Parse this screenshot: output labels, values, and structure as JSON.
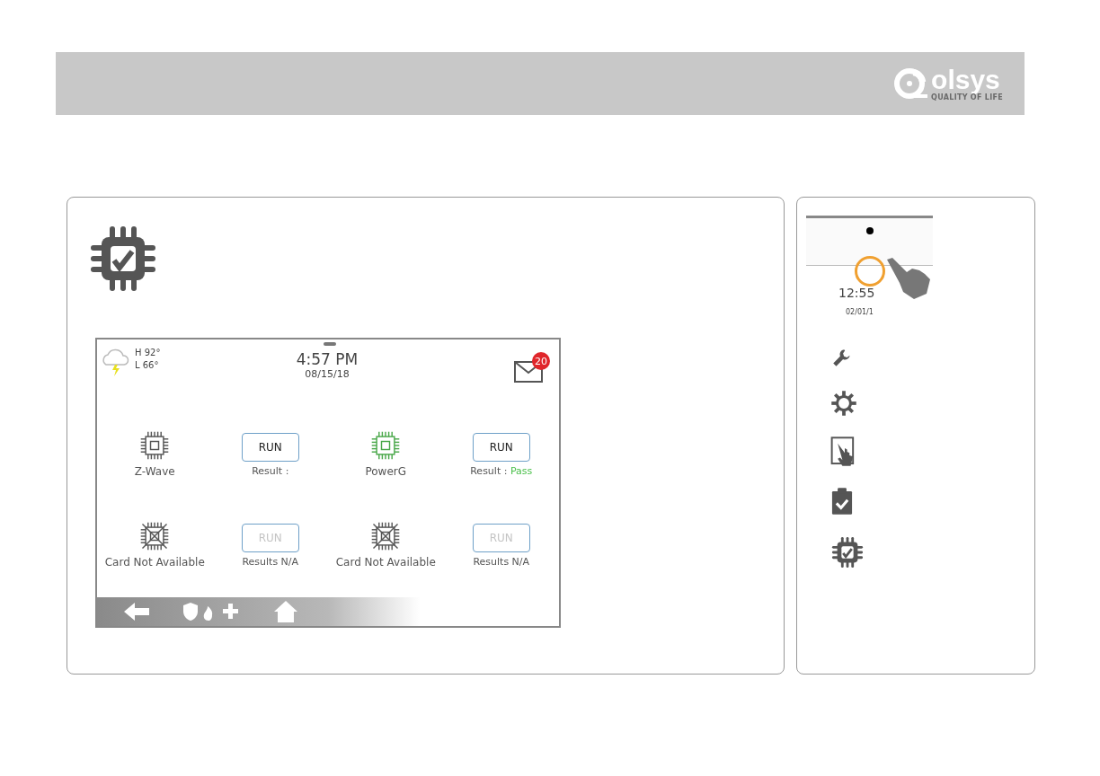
{
  "header": {
    "logo": {
      "name": "olsys",
      "tagline": "QUALITY OF LIFE"
    }
  },
  "screen": {
    "weather": {
      "high": "H 92°",
      "low": "L 66°"
    },
    "time": "4:57 PM",
    "date": "08/15/18",
    "messages": "20",
    "cards": [
      {
        "kind": "available",
        "name": "Z-Wave",
        "color": "#555555",
        "button": "RUN",
        "disabled": false,
        "result": "Result :"
      },
      {
        "kind": "available",
        "name": "PowerG",
        "color": "#4aa84a",
        "button": "RUN",
        "disabled": false,
        "result": "Result :",
        "outcome": "Pass"
      },
      {
        "kind": "unavailable",
        "name": "Card Not Available",
        "color": "#555555",
        "button": "RUN",
        "disabled": true,
        "result": "Results N/A"
      },
      {
        "kind": "unavailable",
        "name": "Card Not Available",
        "color": "#555555",
        "button": "RUN",
        "disabled": true,
        "result": "Results N/A"
      }
    ]
  },
  "sidebar": {
    "time": "12:55",
    "date": "02/01/1",
    "icons": [
      {
        "kind": "wrench"
      },
      {
        "kind": "gear"
      },
      {
        "kind": "touch"
      },
      {
        "kind": "clipboard"
      },
      {
        "kind": "chip"
      }
    ]
  }
}
